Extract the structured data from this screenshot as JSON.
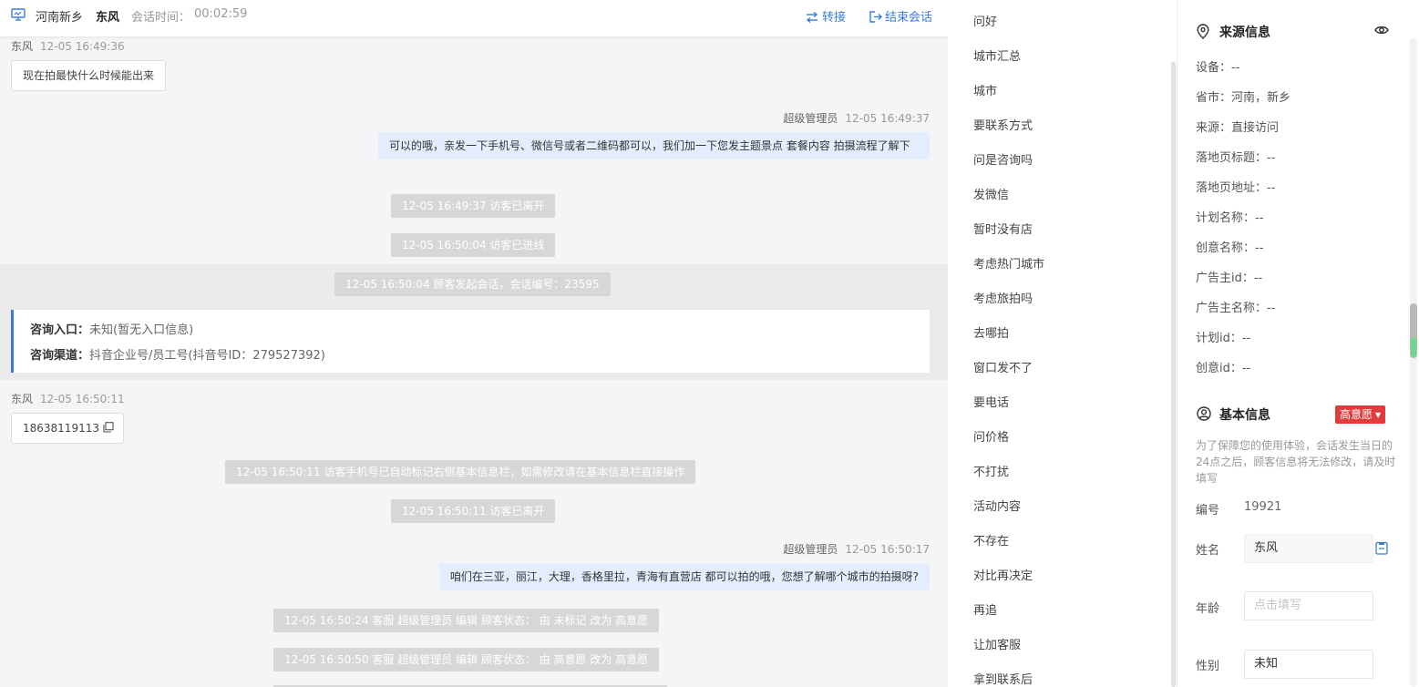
{
  "header": {
    "location": "河南新乡",
    "visitor_name": "东风",
    "session_time_label": "会话时间：",
    "session_time": "00:02:59",
    "transfer_label": "转接",
    "end_label": "结束会话"
  },
  "messages": {
    "m1_sender": "东风",
    "m1_time": "12-05 16:49:36",
    "m1_text": "现在拍最快什么时候能出来",
    "m2_sender": "超级管理员",
    "m2_time": "12-05 16:49:37",
    "m2_text": "可以的哦，亲发一下手机号、微信号或者二维码都可以，我们加一下您发主题景点 套餐内容 拍摄流程了解下",
    "s1": "12-05 16:49:37 访客已离开",
    "s2": "12-05 16:50:04 访客已进线",
    "s3": "12-05 16:50:04 顾客发起会话，会话编号：23595",
    "entry_label": "咨询入口：",
    "entry_value": "未知(暂无入口信息)",
    "channel_label": "咨询渠道：",
    "channel_value": "抖音企业号/员工号(抖音号ID：279527392)",
    "m3_sender": "东风",
    "m3_time": "12-05 16:50:11",
    "m3_text": "18638119113",
    "s4": "12-05 16:50:11 访客手机号已自动标记右侧基本信息栏，如需修改请在基本信息栏直接操作",
    "s5": "12-05 16:50:11 访客已离开",
    "m4_sender": "超级管理员",
    "m4_time": "12-05 16:50:17",
    "m4_text": "咱们在三亚，丽江，大理，香格里拉，青海有直营店 都可以拍的哦，您想了解哪个城市的拍摄呀?",
    "s6": "12-05 16:50:24 客服 超级管理员 编辑 顾客状态： 由 未标记 改为 高意愿",
    "s7": "12-05 16:50:50 客服 超级管理员 编辑 顾客状态： 由 高意愿 改为 高意愿"
  },
  "quick_replies": [
    "问好",
    "城市汇总",
    "城市",
    "要联系方式",
    "问是咨询吗",
    "发微信",
    "暂时没有店",
    "考虑热门城市",
    "考虑旅拍吗",
    "去哪拍",
    "窗口发不了",
    "要电话",
    "问价格",
    "不打扰",
    "活动内容",
    "不存在",
    "对比再决定",
    "再追",
    "让加客服",
    "拿到联系后"
  ],
  "source_info": {
    "title": "来源信息",
    "rows": [
      "设备：--",
      "省市：河南，新乡",
      "来源：直接访问",
      "落地页标题：--",
      "落地页地址：--",
      "计划名称：--",
      "创意名称：--",
      "广告主id：--",
      "广告主名称：--",
      "计划id：--",
      "创意id：--"
    ]
  },
  "basic_info": {
    "title": "基本信息",
    "intent_badge": "高意愿",
    "notice": "为了保障您的使用体验，会话发生当日的24点之后，顾客信息将无法修改，请及时填写",
    "id_label": "编号",
    "id_value": "19921",
    "name_label": "姓名",
    "name_value": "东风",
    "age_label": "年龄",
    "age_placeholder": "点击填写",
    "gender_label": "性别",
    "gender_value": "未知"
  },
  "colors": {
    "accent": "#3a7bd5",
    "badge_red": "#e03c3c",
    "agent_bubble": "#e3edfd",
    "system_msg": "#d7d7d7"
  }
}
